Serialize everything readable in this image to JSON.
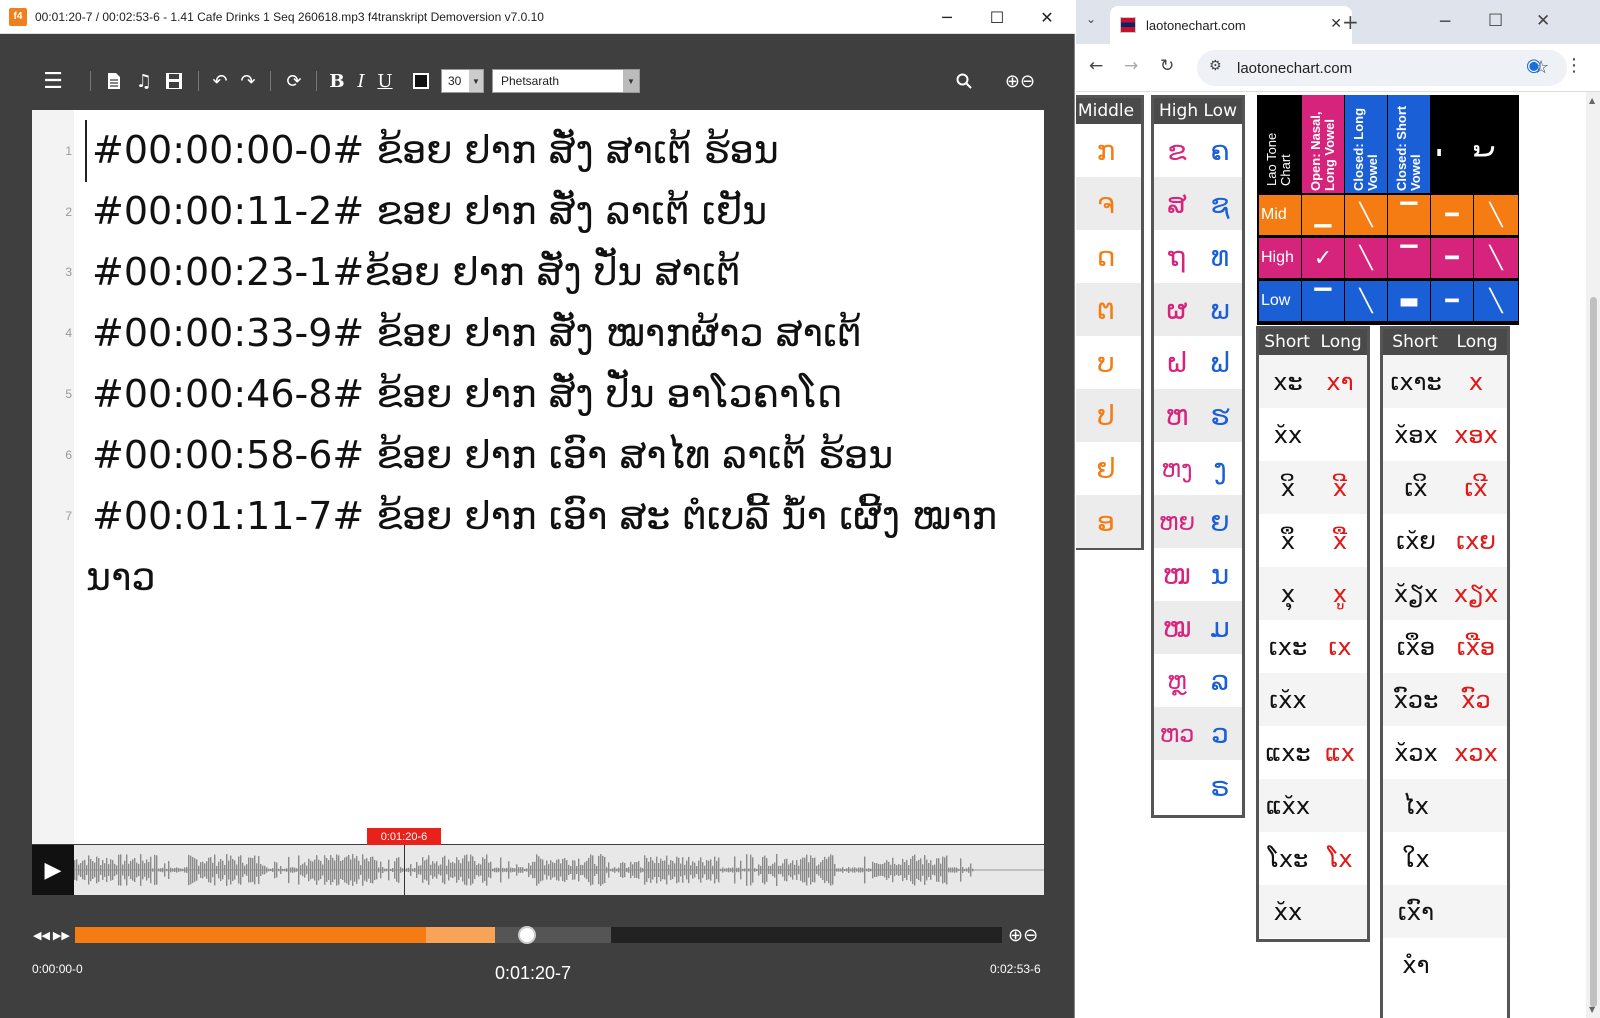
{
  "f4": {
    "app_icon": "f4",
    "window_title": "00:01:20-7 / 00:02:53-6 - 1.41 Cafe Drinks 1 Seq 260618.mp3 f4transkript Demoversion v7.0.10",
    "toolbar": {
      "font_size": "30",
      "font_name": "Phetsarath",
      "text_color": "#111111"
    },
    "editor_lines": [
      {
        "num": "1",
        "text": "#00:00:00-0# ຂ້ອຍ ຢາກ ສັ່ງ ສາເຕ້ ຮ້ອນ"
      },
      {
        "num": "2",
        "text": "#00:00:11-2# ຂອຍ ຢາກ ສັ່ງ ລາເຕ້ ເຢັນ"
      },
      {
        "num": "3",
        "text": "#00:00:23-1#ຂ້ອຍ ຢາກ ສັ່ງ ປັ່ນ ສາເຕ້"
      },
      {
        "num": "4",
        "text": "#00:00:33-9# ຂ້ອຍ ຢາກ ສັ່ງ ໝາກຜ້າວ ສາເຕ້"
      },
      {
        "num": "5",
        "text": "#00:00:46-8# ຂ້ອຍ ຢາກ ສັ່ງ ປັ່ນ ອາໂວຄາໂດ"
      },
      {
        "num": "6",
        "text": "#00:00:58-6# ຂ້ອຍ ຢາກ ເອົາ ສາໄທ ລາເຕ້ ຮ້ອນ"
      },
      {
        "num": "7",
        "text": "#00:01:11-7# ຂ້ອຍ ຢາກ ເອົາ ສະ ຕໍເບລີ້  ນໍ້າ ເຜີ້ງ ໝາກ"
      },
      {
        "num": "",
        "text": "ນາວ"
      }
    ],
    "player": {
      "cursor_time": "0:01:20-6",
      "time_start": "0:00:00-0",
      "time_current": "0:01:20-7",
      "time_end": "0:02:53-6",
      "played_fraction": 0.465,
      "buffer_fraction": 0.664
    }
  },
  "browser": {
    "tab_title": "laotonechart.com",
    "url": "laotonechart.com"
  },
  "tone_chart": {
    "middle_header": "Middle",
    "middle": [
      "ກ",
      "ຈ",
      "ດ",
      "ຕ",
      "ບ",
      "ປ",
      "ຢ",
      "ອ"
    ],
    "high_low_header": "High Low",
    "high_low": [
      [
        "ຂ",
        "ຄ"
      ],
      [
        "ສ",
        "ຊ"
      ],
      [
        "ຖ",
        "ທ"
      ],
      [
        "ຜ",
        "ພ"
      ],
      [
        "ຝ",
        "ຟ"
      ],
      [
        "ຫ",
        "ຮ"
      ],
      [
        "ຫງ",
        "ງ"
      ],
      [
        "ຫຍ",
        "ຍ"
      ],
      [
        "ໜ",
        "ນ"
      ],
      [
        "ໝ",
        "ມ"
      ],
      [
        "ຫຼ",
        "ລ"
      ],
      [
        "ຫວ",
        "ວ"
      ],
      [
        "",
        "ຣ"
      ]
    ],
    "grid_title": "Lao Tone Chart",
    "col_open": "Open: Nasal, Long Vowel",
    "col_closed_long": "Closed: Long Vowel",
    "col_closed_short": "Closed: Short Vowel",
    "mark_1": "່",
    "mark_2": "້",
    "rows": [
      {
        "label": "Mid",
        "cells": [
          "▁",
          "╲",
          "▔",
          "━",
          "╲"
        ]
      },
      {
        "label": "High",
        "cells": [
          "✓",
          "╲",
          "▔",
          "━",
          "╲"
        ]
      },
      {
        "label": "Low",
        "cells": [
          "▔",
          "╲",
          "▬",
          "━",
          "╲"
        ]
      }
    ],
    "vowels_short_header": "Short",
    "vowels_long_header": "Long",
    "vowels_left": [
      [
        "xະ",
        "xາ"
      ],
      [
        "x̆x",
        ""
      ],
      [
        "xິ",
        "xີ"
      ],
      [
        "xຶ",
        "xື"
      ],
      [
        "xຸ",
        "xູ"
      ],
      [
        "ເxະ",
        "ເx"
      ],
      [
        "ເx̆x",
        ""
      ],
      [
        "ແxະ",
        "ແx"
      ],
      [
        "ແx̆x",
        ""
      ],
      [
        "ໂxະ",
        "ໂx"
      ],
      [
        "x̆x",
        ""
      ]
    ],
    "vowels_right": [
      [
        "ເxາະ",
        "x"
      ],
      [
        "x̆ອx",
        "xອx"
      ],
      [
        "ເxິ",
        "ເxີ"
      ],
      [
        "ເx̆ຍ",
        "ເxຍ"
      ],
      [
        "x̆ຽx",
        "xຽx"
      ],
      [
        "ເxຶອ",
        "ເxືອ"
      ],
      [
        "xົວະ",
        "xົວ"
      ],
      [
        "x̆ວx",
        "xວx"
      ],
      [
        "ໄx",
        ""
      ],
      [
        "ໃx",
        ""
      ],
      [
        "ເxົາ",
        ""
      ],
      [
        "xໍາ",
        ""
      ]
    ],
    "colors": {
      "middle": "#f47c12",
      "high": "#d6247c",
      "low": "#1a5fd6",
      "vowel_short": "#000000",
      "vowel_long_mark": "#e01818"
    }
  }
}
